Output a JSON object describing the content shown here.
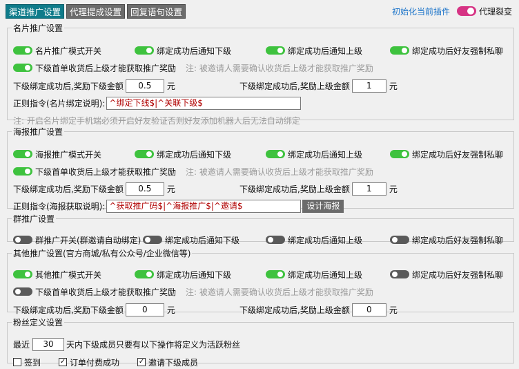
{
  "tabs": [
    {
      "label": "渠道推广设置",
      "active": true
    },
    {
      "label": "代理提成设置",
      "active": false
    },
    {
      "label": "回复语句设置",
      "active": false
    }
  ],
  "header": {
    "init_link": "初始化当前插件",
    "agent_toggle_label": "代理裂变",
    "agent_toggle_on": true
  },
  "card": {
    "legend": "名片推广设置",
    "mode_label": "名片推广模式开关",
    "notify_down": "绑定成功后通知下级",
    "notify_up": "绑定成功后通知上级",
    "force_chat": "绑定成功后好友强制私聊",
    "first_order": "下级首单收货后上级才能获取推广奖励",
    "note1": "注: 被邀请人需要确认收货后上级才能获取推广奖励",
    "reward_down_label": "下级绑定成功后,奖励下级金额",
    "reward_down_value": "0.5",
    "reward_up_label": "下级绑定成功后,奖励上级金额",
    "reward_up_value": "1",
    "unit": "元",
    "regex_label": "正则指令(名片绑定说明):",
    "regex_value": "^绑定下线$|^关联下级$",
    "note2": "注: 开启名片绑定手机端必须开启好友验证否则好友添加机器人后无法自动绑定"
  },
  "poster": {
    "legend": "海报推广设置",
    "mode_label": "海报推广模式开关",
    "notify_down": "绑定成功后通知下级",
    "notify_up": "绑定成功后通知上级",
    "force_chat": "绑定成功后好友强制私聊",
    "first_order": "下级首单收货后上级才能获取推广奖励",
    "note1": "注: 被邀请人需要确认收货后上级才能获取推广奖励",
    "reward_down_label": "下级绑定成功后,奖励下级金额",
    "reward_down_value": "0.5",
    "reward_up_label": "下级绑定成功后,奖励上级金额",
    "reward_up_value": "1",
    "unit": "元",
    "regex_label": "正则指令(海报获取说明):",
    "regex_value": "^获取推广码$|^海报推广$|^邀请$",
    "design_button": "设计海报"
  },
  "group": {
    "legend": "群推广设置",
    "mode_label": "群推广开关(群邀请自动绑定)",
    "notify_down": "绑定成功后通知下级",
    "notify_up": "绑定成功后通知上级",
    "force_chat": "绑定成功后好友强制私聊"
  },
  "other": {
    "legend": "其他推广设置(官方商城/私有公众号/企业微信等)",
    "mode_label": "其他推广模式开关",
    "notify_down": "绑定成功后通知下级",
    "notify_up": "绑定成功后通知上级",
    "force_chat": "绑定成功后好友强制私聊",
    "first_order": "下级首单收货后上级才能获取推广奖励",
    "note1": "注: 被邀请人需要确认收货后上级才能获取推广奖励",
    "reward_down_label": "下级绑定成功后,奖励下级金额",
    "reward_down_value": "0",
    "reward_up_label": "下级绑定成功后,奖励上级金额",
    "reward_up_value": "0",
    "unit": "元"
  },
  "fans": {
    "legend": "粉丝定义设置",
    "recent_label": "最近",
    "days_value": "30",
    "days_suffix": "天内下级成员只要有以下操作将定义为活跃粉丝",
    "checks": [
      {
        "label": "签到",
        "checked": false
      },
      {
        "label": "订单付费成功",
        "checked": true
      },
      {
        "label": "邀请下级成员",
        "checked": true
      }
    ]
  },
  "colors": {
    "active_tab": "#0f7b8a",
    "toggle_on": "#3ec23e",
    "toggle_off": "#5a5a5a",
    "agent_toggle": "#d63384",
    "link": "#1a73c9"
  }
}
